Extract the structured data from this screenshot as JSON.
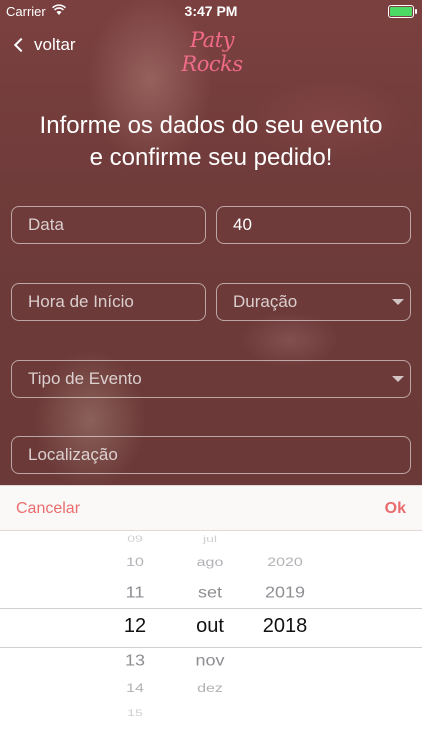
{
  "status_bar": {
    "carrier": "Carrier",
    "time": "3:47 PM"
  },
  "header": {
    "back_label": "voltar",
    "logo_text": "Paty Rocks"
  },
  "title": {
    "line1": "Informe os dados do seu evento",
    "line2": "e confirme seu pedido!"
  },
  "form": {
    "data_placeholder": "Data",
    "guests_value": "40",
    "hora_placeholder": "Hora de Início",
    "duracao_placeholder": "Duração",
    "tipo_placeholder": "Tipo de Evento",
    "localizacao_placeholder": "Localização"
  },
  "picker": {
    "cancel_label": "Cancelar",
    "ok_label": "Ok",
    "days": [
      "09",
      "10",
      "11",
      "12",
      "13",
      "14",
      "15"
    ],
    "months": [
      "jul",
      "ago",
      "set",
      "out",
      "nov",
      "dez"
    ],
    "years": [
      "2020",
      "2019",
      "2018"
    ],
    "selected": {
      "day": "12",
      "month": "out",
      "year": "2018"
    }
  },
  "colors": {
    "accent": "#ea6d6d",
    "overlay": "#6e3b3a",
    "logo": "#f06a8a"
  }
}
